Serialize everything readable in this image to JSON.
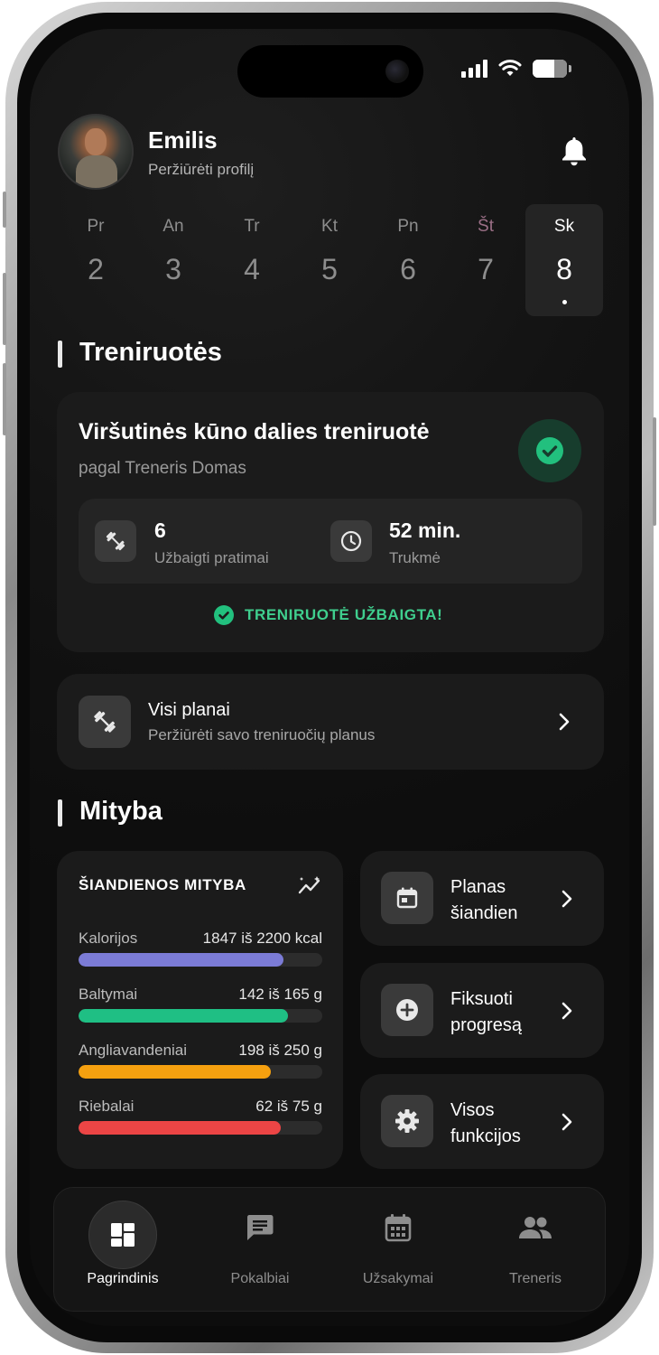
{
  "user": {
    "name": "Emilis",
    "profile_link": "Peržiūrėti profilį"
  },
  "week": [
    {
      "name": "Pr",
      "date": "2"
    },
    {
      "name": "An",
      "date": "3"
    },
    {
      "name": "Tr",
      "date": "4"
    },
    {
      "name": "Kt",
      "date": "5"
    },
    {
      "name": "Pn",
      "date": "6"
    },
    {
      "name": "Št",
      "date": "7"
    },
    {
      "name": "Sk",
      "date": "8",
      "selected": true
    }
  ],
  "trainings": {
    "section_title": "Treniruotės",
    "workout": {
      "title": "Viršutinės kūno dalies treniruotė",
      "trainer": "pagal Treneris Domas",
      "exercises_value": "6",
      "exercises_label": "Užbaigti pratimai",
      "duration_value": "52 min.",
      "duration_label": "Trukmė",
      "status": "TRENIRUOTĖ UŽBAIGTA!"
    },
    "plans": {
      "title": "Visi planai",
      "subtitle": "Peržiūrėti savo treniruočių planus"
    }
  },
  "nutrition": {
    "section_title": "Mityba",
    "card_title": "ŠIANDIENOS MITYBA",
    "items": [
      {
        "label": "Kalorijos",
        "value": "1847 iš 2200 kcal",
        "progress": 0.84,
        "color": "#7b7bd6"
      },
      {
        "label": "Baltymai",
        "value": "142 iš 165 g",
        "progress": 0.86,
        "color": "#1fbf84"
      },
      {
        "label": "Angliavandeniai",
        "value": "198 iš 250 g",
        "progress": 0.79,
        "color": "#f5a00f"
      },
      {
        "label": "Riebalai",
        "value": "62 iš 75 g",
        "progress": 0.83,
        "color": "#ec4545"
      }
    ],
    "actions": [
      {
        "line1": "Planas",
        "line2": "šiandien",
        "icon": "calendar-icon"
      },
      {
        "line1": "Fiksuoti",
        "line2": "progresą",
        "icon": "plus-circle-icon"
      },
      {
        "line1": "Visos",
        "line2": "funkcijos",
        "icon": "gear-icon"
      }
    ]
  },
  "tabs": [
    {
      "label": "Pagrindinis",
      "icon": "dashboard-icon",
      "active": true
    },
    {
      "label": "Pokalbiai",
      "icon": "chat-icon"
    },
    {
      "label": "Užsakymai",
      "icon": "calendar-icon"
    },
    {
      "label": "Treneris",
      "icon": "people-icon"
    }
  ],
  "colors": {
    "success": "#22c07e",
    "success_text": "#3fcf8e",
    "weekend_day": "#9b6f86"
  }
}
